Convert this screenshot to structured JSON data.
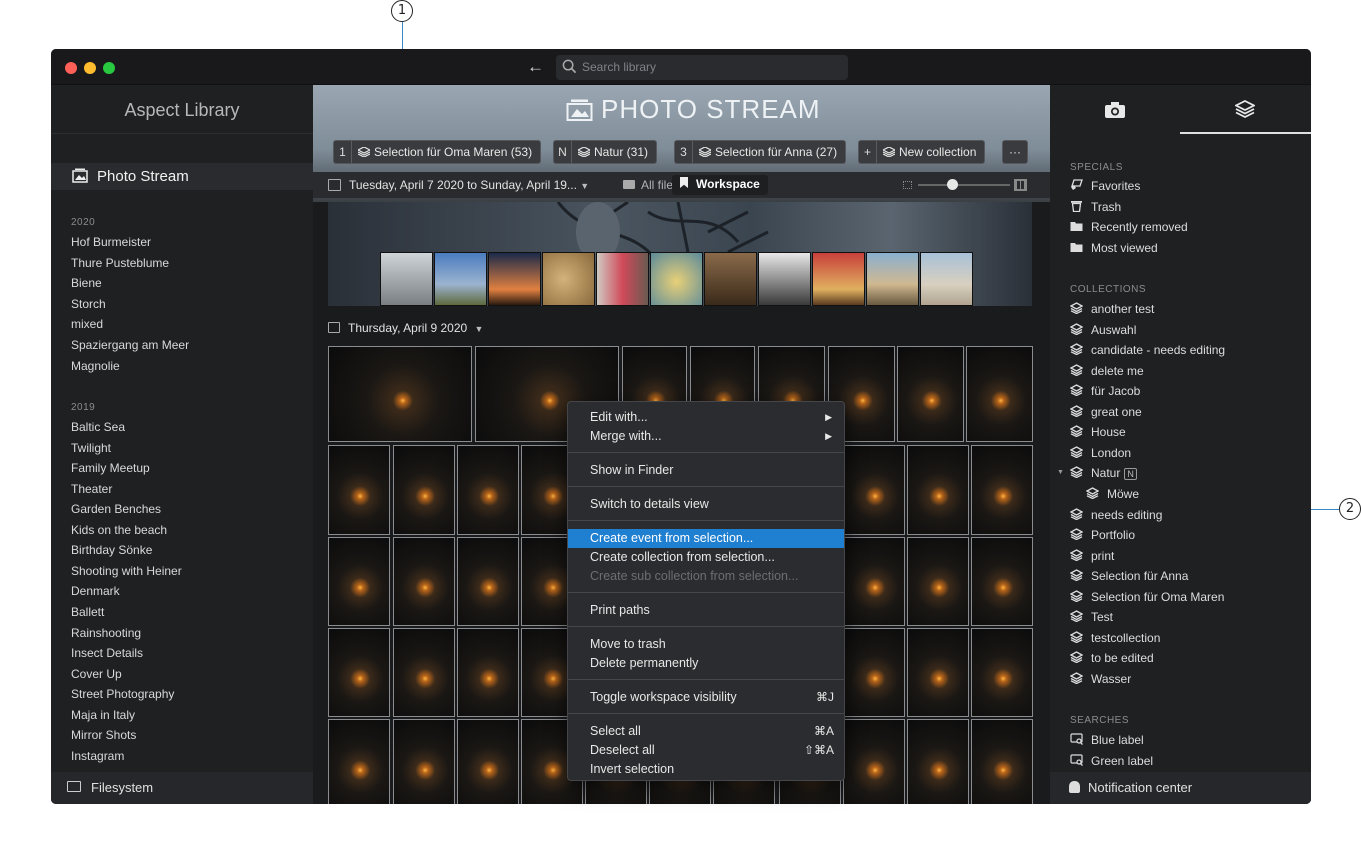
{
  "callouts": {
    "one": "1",
    "two": "2"
  },
  "search": {
    "placeholder": "Search library"
  },
  "sidebar": {
    "library_title": "Aspect Library",
    "photo_stream": "Photo Stream",
    "year1": "2020",
    "items_2020": [
      "Hof Burmeister",
      "Thure Pusteblume",
      "Biene",
      "Storch",
      "mixed",
      "Spaziergang am Meer",
      "Magnolie"
    ],
    "year2": "2019",
    "items_2019": [
      "Baltic Sea",
      "Twilight",
      "Family Meetup",
      "Theater",
      "Garden Benches",
      "Kids on the beach",
      "Birthday Sönke",
      "Shooting with Heiner",
      "Denmark",
      "Ballett",
      "Rainshooting",
      "Insect Details",
      "Cover Up",
      "Street Photography",
      "Maja in Italy",
      "Mirror Shots",
      "Instagram"
    ],
    "filesystem": "Filesystem"
  },
  "header": {
    "title": "PHOTO STREAM",
    "chips": [
      {
        "key": "1",
        "label": "Selection für Oma Maren (53)"
      },
      {
        "key": "N",
        "label": "Natur (31)"
      },
      {
        "key": "3",
        "label": "Selection für Anna (27)"
      },
      {
        "key": "+",
        "label": "New collection"
      }
    ],
    "more": "···"
  },
  "filter": {
    "date_range": "Tuesday, April 7 2020 to Sunday, April 19...",
    "all_files": "All files",
    "workspace": "Workspace",
    "zoom_level": 0.38
  },
  "day": {
    "label": "Thursday, April 9 2020"
  },
  "context_menu": {
    "edit_with": "Edit with...",
    "merge_with": "Merge with...",
    "show_in_finder": "Show in Finder",
    "switch_details": "Switch to details view",
    "create_event": "Create event from selection...",
    "create_collection": "Create collection from selection...",
    "create_sub": "Create sub collection from selection...",
    "print_paths": "Print paths",
    "move_trash": "Move to trash",
    "delete_perm": "Delete permanently",
    "toggle_ws": "Toggle workspace visibility",
    "toggle_ws_sc": "⌘J",
    "select_all": "Select all",
    "select_all_sc": "⌘A",
    "deselect_all": "Deselect all",
    "deselect_all_sc": "⇧⌘A",
    "invert": "Invert selection"
  },
  "right": {
    "specials_heading": "SPECIALS",
    "specials": [
      "Favorites",
      "Trash",
      "Recently removed",
      "Most viewed"
    ],
    "collections_heading": "COLLECTIONS",
    "collections": [
      "another test",
      "Auswahl",
      "candidate - needs editing",
      "delete me",
      "für Jacob",
      "great one",
      "House",
      "London",
      "Natur",
      "Möwe",
      "needs editing",
      "Portfolio",
      "print",
      "Selection für Anna",
      "Selection für Oma Maren",
      "Test",
      "testcollection",
      "to be edited",
      "Wasser"
    ],
    "natur_badge": "N",
    "searches_heading": "SEARCHES",
    "searches": [
      "Blue label",
      "Green label"
    ],
    "notification": "Notification center"
  }
}
